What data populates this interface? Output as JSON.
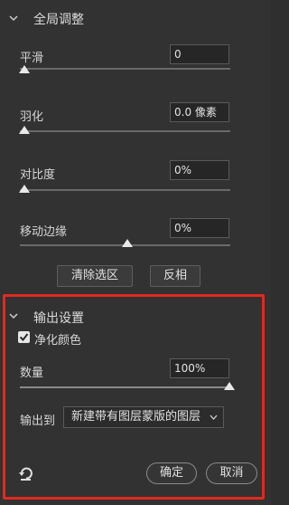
{
  "global_adjust": {
    "title": "全局调整",
    "smooth": {
      "label": "平滑",
      "value": "0",
      "slider": 0.0
    },
    "feather": {
      "label": "羽化",
      "value": "0.0 像素",
      "slider": 0.0
    },
    "contrast": {
      "label": "对比度",
      "value": "0%",
      "slider": 0.0
    },
    "shift_edge": {
      "label": "移动边缘",
      "value": "0%",
      "slider": 0.5
    },
    "clear_selection_label": "清除选区",
    "invert_label": "反相"
  },
  "output_settings": {
    "title": "输出设置",
    "decontaminate": {
      "label": "净化颜色",
      "checked": true
    },
    "amount": {
      "label": "数量",
      "value": "100%",
      "slider": 1.0
    },
    "output_to": {
      "label": "输出到",
      "selected": "新建带有图层蒙版的图层"
    }
  },
  "footer": {
    "ok_label": "确定",
    "cancel_label": "取消"
  },
  "colors": {
    "highlight_border": "#e02a1e",
    "panel_bg": "#323232",
    "field_bg": "#262626"
  },
  "icons": {
    "collapse": "chevron-down-icon",
    "reset": "reset-icon",
    "check": "checkmark-icon",
    "dropdown": "caret-down-icon"
  }
}
